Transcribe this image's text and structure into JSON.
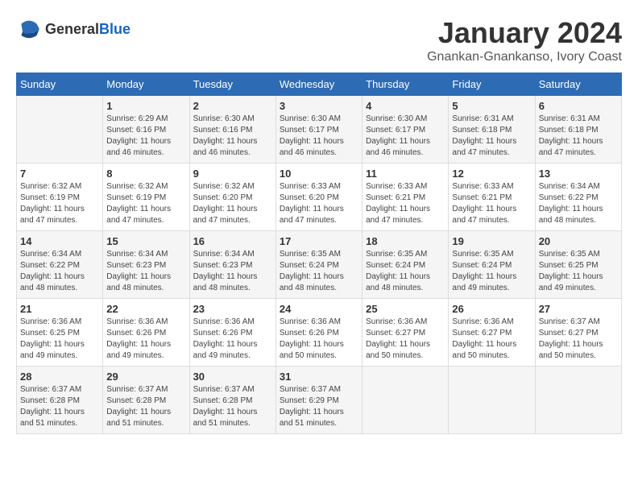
{
  "logo": {
    "text_general": "General",
    "text_blue": "Blue"
  },
  "title": "January 2024",
  "subtitle": "Gnankan-Gnankanso, Ivory Coast",
  "days_of_week": [
    "Sunday",
    "Monday",
    "Tuesday",
    "Wednesday",
    "Thursday",
    "Friday",
    "Saturday"
  ],
  "weeks": [
    [
      {
        "day": "",
        "sunrise": "",
        "sunset": "",
        "daylight": ""
      },
      {
        "day": "1",
        "sunrise": "Sunrise: 6:29 AM",
        "sunset": "Sunset: 6:16 PM",
        "daylight": "Daylight: 11 hours and 46 minutes."
      },
      {
        "day": "2",
        "sunrise": "Sunrise: 6:30 AM",
        "sunset": "Sunset: 6:16 PM",
        "daylight": "Daylight: 11 hours and 46 minutes."
      },
      {
        "day": "3",
        "sunrise": "Sunrise: 6:30 AM",
        "sunset": "Sunset: 6:17 PM",
        "daylight": "Daylight: 11 hours and 46 minutes."
      },
      {
        "day": "4",
        "sunrise": "Sunrise: 6:30 AM",
        "sunset": "Sunset: 6:17 PM",
        "daylight": "Daylight: 11 hours and 46 minutes."
      },
      {
        "day": "5",
        "sunrise": "Sunrise: 6:31 AM",
        "sunset": "Sunset: 6:18 PM",
        "daylight": "Daylight: 11 hours and 47 minutes."
      },
      {
        "day": "6",
        "sunrise": "Sunrise: 6:31 AM",
        "sunset": "Sunset: 6:18 PM",
        "daylight": "Daylight: 11 hours and 47 minutes."
      }
    ],
    [
      {
        "day": "7",
        "sunrise": "Sunrise: 6:32 AM",
        "sunset": "Sunset: 6:19 PM",
        "daylight": "Daylight: 11 hours and 47 minutes."
      },
      {
        "day": "8",
        "sunrise": "Sunrise: 6:32 AM",
        "sunset": "Sunset: 6:19 PM",
        "daylight": "Daylight: 11 hours and 47 minutes."
      },
      {
        "day": "9",
        "sunrise": "Sunrise: 6:32 AM",
        "sunset": "Sunset: 6:20 PM",
        "daylight": "Daylight: 11 hours and 47 minutes."
      },
      {
        "day": "10",
        "sunrise": "Sunrise: 6:33 AM",
        "sunset": "Sunset: 6:20 PM",
        "daylight": "Daylight: 11 hours and 47 minutes."
      },
      {
        "day": "11",
        "sunrise": "Sunrise: 6:33 AM",
        "sunset": "Sunset: 6:21 PM",
        "daylight": "Daylight: 11 hours and 47 minutes."
      },
      {
        "day": "12",
        "sunrise": "Sunrise: 6:33 AM",
        "sunset": "Sunset: 6:21 PM",
        "daylight": "Daylight: 11 hours and 47 minutes."
      },
      {
        "day": "13",
        "sunrise": "Sunrise: 6:34 AM",
        "sunset": "Sunset: 6:22 PM",
        "daylight": "Daylight: 11 hours and 48 minutes."
      }
    ],
    [
      {
        "day": "14",
        "sunrise": "Sunrise: 6:34 AM",
        "sunset": "Sunset: 6:22 PM",
        "daylight": "Daylight: 11 hours and 48 minutes."
      },
      {
        "day": "15",
        "sunrise": "Sunrise: 6:34 AM",
        "sunset": "Sunset: 6:23 PM",
        "daylight": "Daylight: 11 hours and 48 minutes."
      },
      {
        "day": "16",
        "sunrise": "Sunrise: 6:34 AM",
        "sunset": "Sunset: 6:23 PM",
        "daylight": "Daylight: 11 hours and 48 minutes."
      },
      {
        "day": "17",
        "sunrise": "Sunrise: 6:35 AM",
        "sunset": "Sunset: 6:24 PM",
        "daylight": "Daylight: 11 hours and 48 minutes."
      },
      {
        "day": "18",
        "sunrise": "Sunrise: 6:35 AM",
        "sunset": "Sunset: 6:24 PM",
        "daylight": "Daylight: 11 hours and 48 minutes."
      },
      {
        "day": "19",
        "sunrise": "Sunrise: 6:35 AM",
        "sunset": "Sunset: 6:24 PM",
        "daylight": "Daylight: 11 hours and 49 minutes."
      },
      {
        "day": "20",
        "sunrise": "Sunrise: 6:35 AM",
        "sunset": "Sunset: 6:25 PM",
        "daylight": "Daylight: 11 hours and 49 minutes."
      }
    ],
    [
      {
        "day": "21",
        "sunrise": "Sunrise: 6:36 AM",
        "sunset": "Sunset: 6:25 PM",
        "daylight": "Daylight: 11 hours and 49 minutes."
      },
      {
        "day": "22",
        "sunrise": "Sunrise: 6:36 AM",
        "sunset": "Sunset: 6:26 PM",
        "daylight": "Daylight: 11 hours and 49 minutes."
      },
      {
        "day": "23",
        "sunrise": "Sunrise: 6:36 AM",
        "sunset": "Sunset: 6:26 PM",
        "daylight": "Daylight: 11 hours and 49 minutes."
      },
      {
        "day": "24",
        "sunrise": "Sunrise: 6:36 AM",
        "sunset": "Sunset: 6:26 PM",
        "daylight": "Daylight: 11 hours and 50 minutes."
      },
      {
        "day": "25",
        "sunrise": "Sunrise: 6:36 AM",
        "sunset": "Sunset: 6:27 PM",
        "daylight": "Daylight: 11 hours and 50 minutes."
      },
      {
        "day": "26",
        "sunrise": "Sunrise: 6:36 AM",
        "sunset": "Sunset: 6:27 PM",
        "daylight": "Daylight: 11 hours and 50 minutes."
      },
      {
        "day": "27",
        "sunrise": "Sunrise: 6:37 AM",
        "sunset": "Sunset: 6:27 PM",
        "daylight": "Daylight: 11 hours and 50 minutes."
      }
    ],
    [
      {
        "day": "28",
        "sunrise": "Sunrise: 6:37 AM",
        "sunset": "Sunset: 6:28 PM",
        "daylight": "Daylight: 11 hours and 51 minutes."
      },
      {
        "day": "29",
        "sunrise": "Sunrise: 6:37 AM",
        "sunset": "Sunset: 6:28 PM",
        "daylight": "Daylight: 11 hours and 51 minutes."
      },
      {
        "day": "30",
        "sunrise": "Sunrise: 6:37 AM",
        "sunset": "Sunset: 6:28 PM",
        "daylight": "Daylight: 11 hours and 51 minutes."
      },
      {
        "day": "31",
        "sunrise": "Sunrise: 6:37 AM",
        "sunset": "Sunset: 6:29 PM",
        "daylight": "Daylight: 11 hours and 51 minutes."
      },
      {
        "day": "",
        "sunrise": "",
        "sunset": "",
        "daylight": ""
      },
      {
        "day": "",
        "sunrise": "",
        "sunset": "",
        "daylight": ""
      },
      {
        "day": "",
        "sunrise": "",
        "sunset": "",
        "daylight": ""
      }
    ]
  ]
}
